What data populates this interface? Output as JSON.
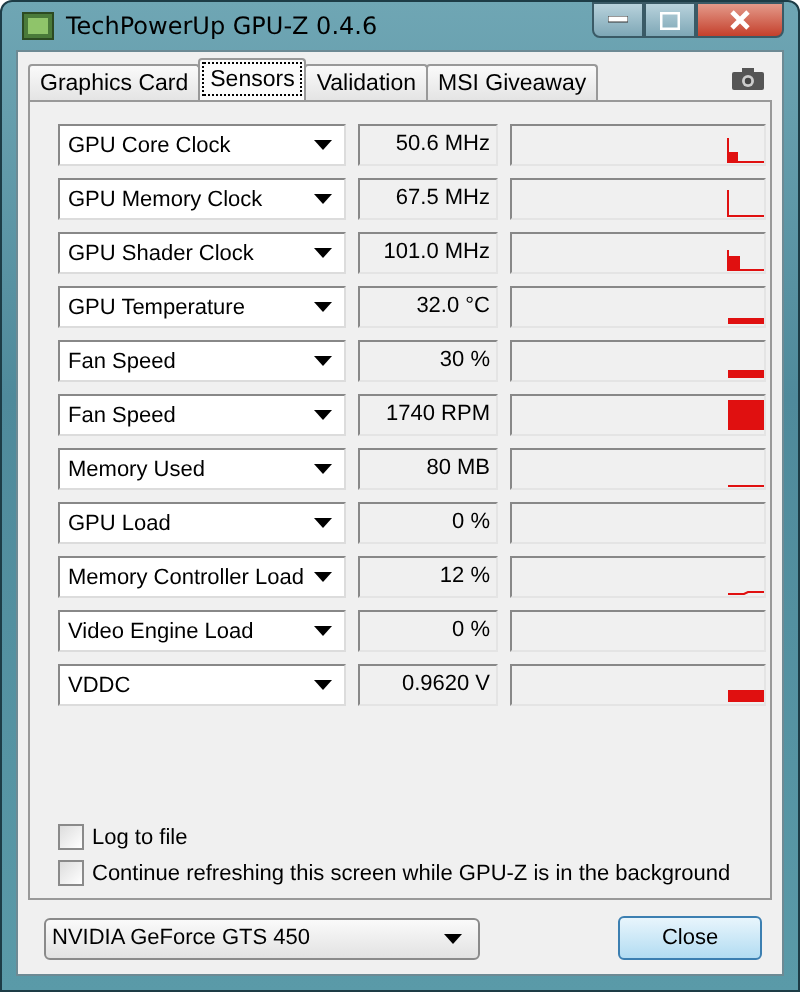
{
  "window": {
    "title": "TechPowerUp GPU-Z 0.4.6"
  },
  "tabs": [
    {
      "label": "Graphics Card",
      "selected": false
    },
    {
      "label": "Sensors",
      "selected": true
    },
    {
      "label": "Validation",
      "selected": false
    },
    {
      "label": "MSI Giveaway",
      "selected": false
    }
  ],
  "sensors": [
    {
      "name": "GPU Core Clock",
      "reading": "50.6 MHz"
    },
    {
      "name": "GPU Memory Clock",
      "reading": "67.5 MHz"
    },
    {
      "name": "GPU Shader Clock",
      "reading": "101.0 MHz"
    },
    {
      "name": "GPU Temperature",
      "reading": "32.0 °C"
    },
    {
      "name": "Fan Speed",
      "reading": "30 %"
    },
    {
      "name": "Fan Speed",
      "reading": "1740 RPM"
    },
    {
      "name": "Memory Used",
      "reading": "80 MB"
    },
    {
      "name": "GPU Load",
      "reading": "0 %"
    },
    {
      "name": "Memory Controller Load",
      "reading": "12 %"
    },
    {
      "name": "Video Engine Load",
      "reading": "0 %"
    },
    {
      "name": "VDDC",
      "reading": "0.9620 V"
    }
  ],
  "options": [
    {
      "label": "Log to file",
      "checked": false
    },
    {
      "label": "Continue refreshing this screen while GPU-Z is in the background",
      "checked": false
    }
  ],
  "card_select": {
    "value": "NVIDIA GeForce GTS 450"
  },
  "close_button": {
    "label": "Close"
  }
}
